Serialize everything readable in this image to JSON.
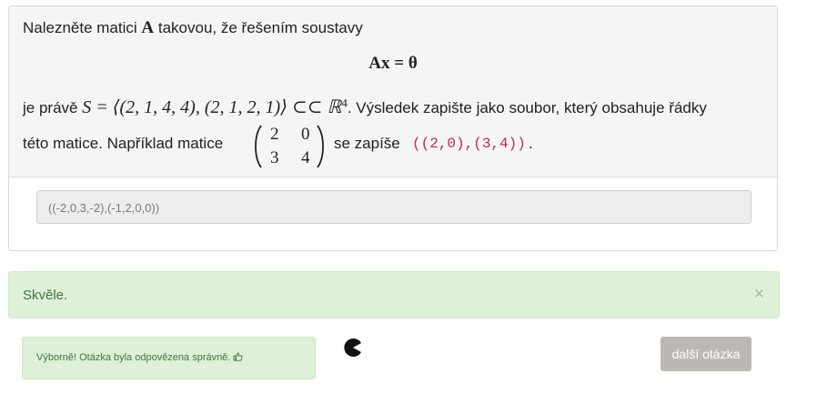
{
  "question": {
    "intro": "Nalezněte matici",
    "matrix_symbol": "A",
    "intro_rest": "takovou, že řešením soustavy",
    "equation": "Ax = θ",
    "line2_prefix": "je právě",
    "line2_math": "S = ⟨(2, 1, 4, 4), (2, 1, 2, 1)⟩ ⊂⊂ ℝ",
    "line2_sup": "4",
    "line2_suffix": ". Výsledek zapište jako soubor, který obsahuje řádky",
    "line3_prefix": "této matice. Například matice",
    "example_matrix": [
      "2",
      "0",
      "3",
      "4"
    ],
    "line3_mid": "se zapíše",
    "code_example": "((2,0),(3,4))",
    "line3_end": "."
  },
  "answer_value": "((-2,0,3,-2),(-1,2,0,0))",
  "alert": {
    "message": "Skvěle.",
    "close_label": "×"
  },
  "feedback": {
    "text": "Výborně! Otázka byla odpovězena správně.",
    "icon": "thumbs-up-icon"
  },
  "spinner_icon": "pacman-icon",
  "next_button": {
    "label": "další otázka"
  },
  "colors": {
    "success_bg": "#dff0d8",
    "success_text": "#3c763d",
    "code_color": "#c7254e",
    "button_bg": "#bdb8b4"
  }
}
